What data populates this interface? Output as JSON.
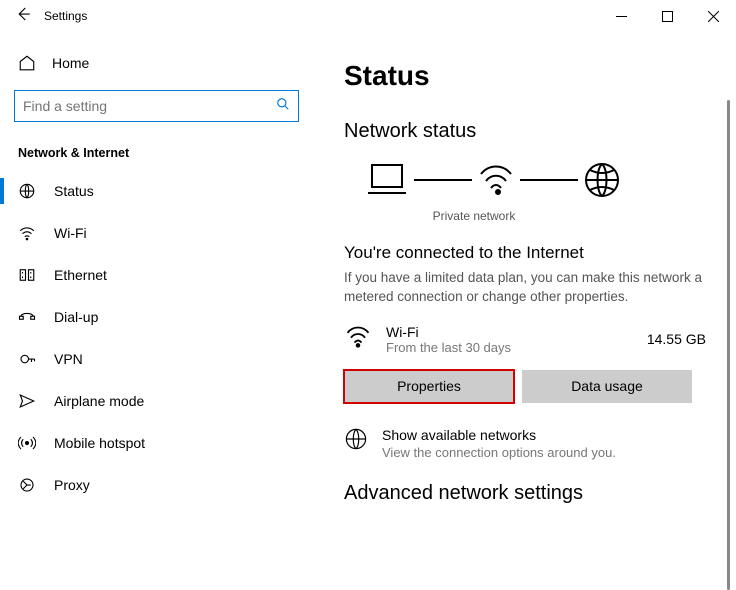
{
  "titlebar": {
    "title": "Settings"
  },
  "sidebar": {
    "home": "Home",
    "search_placeholder": "Find a setting",
    "category": "Network & Internet",
    "items": [
      {
        "label": "Status"
      },
      {
        "label": "Wi-Fi"
      },
      {
        "label": "Ethernet"
      },
      {
        "label": "Dial-up"
      },
      {
        "label": "VPN"
      },
      {
        "label": "Airplane mode"
      },
      {
        "label": "Mobile hotspot"
      },
      {
        "label": "Proxy"
      }
    ]
  },
  "main": {
    "page_title": "Status",
    "section1_title": "Network status",
    "diagram_caption": "Private network",
    "connected_title": "You're connected to the Internet",
    "connected_desc": "If you have a limited data plan, you can make this network a metered connection or change other properties.",
    "wifi_label": "Wi-Fi",
    "wifi_sub": "From the last 30 days",
    "wifi_amount": "14.55 GB",
    "btn_properties": "Properties",
    "btn_datausage": "Data usage",
    "avail_title": "Show available networks",
    "avail_sub": "View the connection options around you.",
    "advanced_title": "Advanced network settings"
  }
}
